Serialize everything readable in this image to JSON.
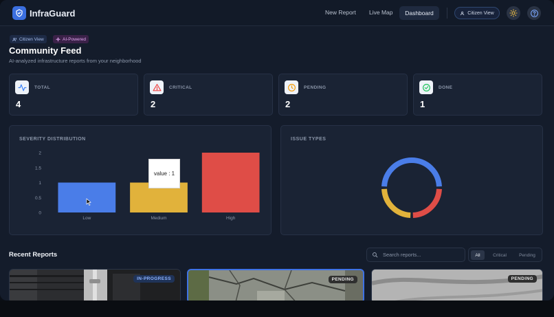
{
  "nav": {
    "brand": "InfraGuard",
    "links": [
      "New Report",
      "Live Map"
    ],
    "active": "Dashboard",
    "citizen_view": "Citizen View",
    "theme_icon": "sun-icon",
    "help_icon": "help-icon"
  },
  "header": {
    "badges": [
      "Citizen View",
      "AI-Powered"
    ],
    "title": "Community Feed",
    "subtitle": "AI-analyzed infrastructure reports from your neighborhood"
  },
  "stats": [
    {
      "label": "TOTAL",
      "value": "4",
      "icon": "activity-icon",
      "color": "#3b82f6"
    },
    {
      "label": "CRITICAL",
      "value": "2",
      "icon": "alert-triangle-icon",
      "color": "#ef4444"
    },
    {
      "label": "PENDING",
      "value": "2",
      "icon": "clock-icon",
      "color": "#f59e0b"
    },
    {
      "label": "DONE",
      "value": "1",
      "icon": "check-circle-icon",
      "color": "#22c55e"
    }
  ],
  "severity_panel": {
    "title": "SEVERITY DISTRIBUTION",
    "tooltip": "value : 1"
  },
  "issue_panel": {
    "title": "ISSUE TYPES"
  },
  "chart_data": [
    {
      "type": "bar",
      "title": "SEVERITY DISTRIBUTION",
      "categories": [
        "Low",
        "Medium",
        "High"
      ],
      "values": [
        1,
        1,
        2
      ],
      "colors": [
        "#4a7de8",
        "#e1b23b",
        "#df4d47"
      ],
      "ylim": [
        0,
        2
      ],
      "yticks": [
        "0",
        "0.5",
        "1",
        "1.5",
        "2"
      ],
      "grid": false
    },
    {
      "type": "pie",
      "title": "ISSUE TYPES",
      "values": [
        2,
        1,
        1
      ],
      "colors": [
        "#4a7de8",
        "#df4d47",
        "#e1b23b"
      ]
    }
  ],
  "recent": {
    "title": "Recent Reports",
    "search_placeholder": "Search reports...",
    "filters": [
      "All",
      "Critical",
      "Pending"
    ],
    "active_filter": "All",
    "reports": [
      {
        "status": "IN-PROGRESS"
      },
      {
        "status": "PENDING"
      },
      {
        "status": "PENDING"
      }
    ]
  },
  "colors": {
    "accent": "#3b6fe0",
    "background": "#141c2b",
    "card": "#1a2334"
  }
}
